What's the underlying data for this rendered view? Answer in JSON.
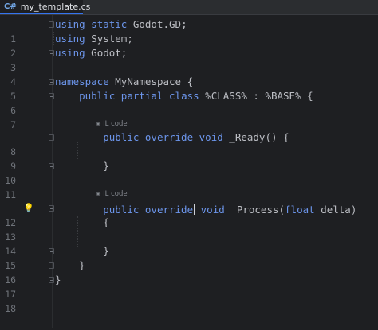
{
  "tab": {
    "lang_badge": "C#",
    "file_name": "my_template.cs"
  },
  "gutter": {
    "line_numbers": [
      "1",
      "2",
      "3",
      "4",
      "5",
      "6",
      "7",
      "8",
      "9",
      "10",
      "11",
      "12",
      "13",
      "14",
      "15",
      "16",
      "17",
      "18"
    ]
  },
  "code": {
    "l1": {
      "kw1": "using",
      "kw2": "static",
      "rest": "Godot.GD;"
    },
    "l2": {
      "kw1": "using",
      "rest": "System;"
    },
    "l3": {
      "kw1": "using",
      "rest": "Godot;"
    },
    "l5": {
      "kw1": "namespace",
      "rest": "MyNamespace {"
    },
    "l6": {
      "kw1": "public",
      "kw2": "partial",
      "kw3": "class",
      "rest": "%CLASS% : %BASE% {"
    },
    "l8": {
      "kw1": "public",
      "kw2": "override",
      "kw3": "void",
      "rest": "_Ready() {"
    },
    "l10": {
      "rest": "}"
    },
    "l12": {
      "kw1": "public",
      "kw2": "override",
      "kw3": "void",
      "rest1": "_Process(",
      "kw4": "float",
      "rest2": " delta)"
    },
    "l13": {
      "rest": "{"
    },
    "l15": {
      "rest": "}"
    },
    "l16": {
      "rest": "}"
    },
    "l17": {
      "rest": "}"
    }
  },
  "hints": {
    "ready": "IL code",
    "process": "IL code"
  },
  "icons": {
    "fold": "fold-marker-icon",
    "bulb": "lightbulb-icon",
    "hint": "diamond-icon"
  },
  "colors": {
    "keyword": "#6c95eb",
    "text": "#bcbec4",
    "line_number": "#6f737a",
    "background": "#1e1f22"
  }
}
